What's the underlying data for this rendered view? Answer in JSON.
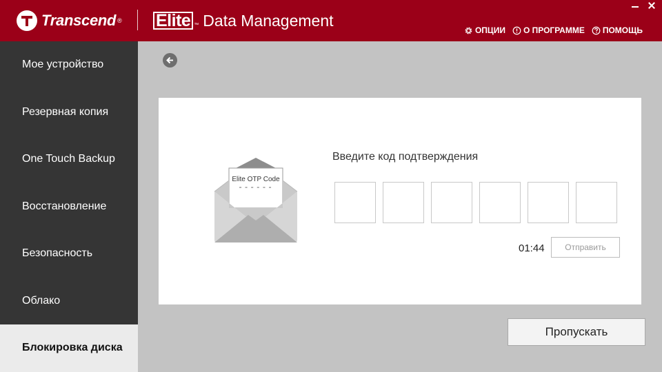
{
  "header": {
    "brand": "Transcend",
    "brand_reg": "®",
    "product_logo": "Elite",
    "product_tm": "™",
    "product_name": "Data Management",
    "nav": [
      {
        "label": "ОПЦИИ",
        "icon": "gear-icon"
      },
      {
        "label": "О ПРОГРАММЕ",
        "icon": "info-icon"
      },
      {
        "label": "ПОМОЩЬ",
        "icon": "help-icon"
      }
    ]
  },
  "sidebar": {
    "items": [
      {
        "label": "Мое устройство"
      },
      {
        "label": "Резервная копия"
      },
      {
        "label": "One Touch Backup"
      },
      {
        "label": "Восстановление"
      },
      {
        "label": "Безопасность"
      },
      {
        "label": "Облако"
      },
      {
        "label": "Блокировка диска",
        "active": true
      }
    ]
  },
  "main": {
    "envelope_text": "Elite OTP Code",
    "envelope_dashes": "------",
    "prompt": "Введите код подтверждения",
    "code_values": [
      "",
      "",
      "",
      "",
      "",
      ""
    ],
    "timer": "01:44",
    "send_label": "Отправить",
    "skip_label": "Пропускать"
  },
  "colors": {
    "header_bg": "#9b0018",
    "sidebar_bg": "#353535",
    "content_bg": "#c3c3c3"
  }
}
